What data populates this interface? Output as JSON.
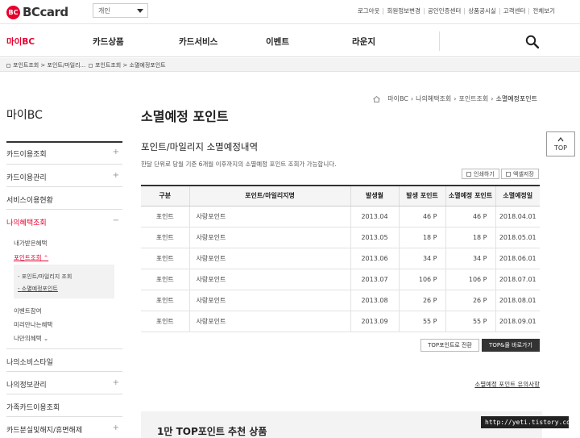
{
  "brand": {
    "mark": "BC",
    "name": "BCcard"
  },
  "card_type_select": {
    "value": "개인"
  },
  "util_links": [
    "로그아웃",
    "회원정보변경",
    "공인인증센터",
    "상품공시실",
    "고객센터",
    "전체보기"
  ],
  "gnb": [
    {
      "label": "마이BC",
      "active": true
    },
    {
      "label": "카드상품"
    },
    {
      "label": "카드서비스"
    },
    {
      "label": "이벤트"
    },
    {
      "label": "라운지"
    }
  ],
  "loc_tabs": [
    "포인트조회 > 포인트/마일리...",
    "포인트조회 > 소멸예정포인트"
  ],
  "lnb": {
    "title": "마이BC",
    "items": [
      {
        "label": "카드이용조회"
      },
      {
        "label": "카드이용관리"
      },
      {
        "label": "서비스이용현황"
      },
      {
        "label": "나의혜택조회"
      }
    ],
    "sub_items": [
      "내가받은혜택",
      "포인트조회",
      "이벤트참여",
      "미리만나는혜택",
      "나만의혜택"
    ],
    "sub_sub_items": [
      "포인트/마일리지 조회",
      "소멸예정포인트"
    ],
    "bottom_items": [
      "나의소비스타일",
      "나의정보관리",
      "가족카드이용조회",
      "카드분실및해지/휴면해제"
    ]
  },
  "breadcrumb": [
    "마이BC",
    "나의혜택조회",
    "포인트조회",
    "소멸예정포인트"
  ],
  "page_title": "소멸예정 포인트",
  "section_title": "포인트/마일리지 소멸예정내역",
  "description": "한달 단위로 당월 기준 6개월 이후까지의 소멸예정 포인트 조회가 가능합니다.",
  "buttons": {
    "print": "인쇄하기",
    "excel": "엑셀저장",
    "convert": "TOP포인트로 전환",
    "shop": "TOP&몰 바로가기"
  },
  "table": {
    "headers": [
      "구분",
      "포인트/마일리지명",
      "발생월",
      "발생 포인트",
      "소멸예정 포인트",
      "소멸예정일"
    ],
    "rows": [
      [
        "포인트",
        "사랑포인트",
        "2013.04",
        "46 P",
        "46 P",
        "2018.04.01"
      ],
      [
        "포인트",
        "사랑포인트",
        "2013.05",
        "18 P",
        "18 P",
        "2018.05.01"
      ],
      [
        "포인트",
        "사랑포인트",
        "2013.06",
        "34 P",
        "34 P",
        "2018.06.01"
      ],
      [
        "포인트",
        "사랑포인트",
        "2013.07",
        "106 P",
        "106 P",
        "2018.07.01"
      ],
      [
        "포인트",
        "사랑포인트",
        "2013.08",
        "26 P",
        "26 P",
        "2018.08.01"
      ],
      [
        "포인트",
        "사랑포인트",
        "2013.09",
        "55 P",
        "55 P",
        "2018.09.01"
      ]
    ]
  },
  "notice_link": "소멸예정 포인트 유의사항",
  "promo_title": "1만 TOP포인트 추천 상품",
  "top_button": "TOP",
  "watermark": "http://yeti.tistory.com"
}
